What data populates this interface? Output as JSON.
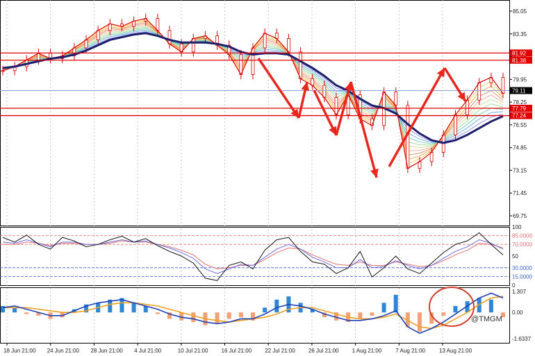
{
  "chart_data": {
    "type": "line",
    "instrument_note": "",
    "colors": {
      "price_candle": "#d60000",
      "trend_ma": "#1c1f6b",
      "level_line": "#e00000",
      "current_price_line": "#8a9fd8",
      "arrow": "#e8261e",
      "stoch_main": "#111111",
      "stoch_signal": "#6a6ae0",
      "stoch_slow": "#e07070",
      "hist_pos": "#2f86d6",
      "hist_neg": "#f2a076",
      "macd_line": "#1c3fb5",
      "signal_line": "#f0a020",
      "circle": "#d63a2a"
    },
    "x_labels": [
      "18 Jun 21:00",
      "24 Jun 21:00",
      "28 Jun 21:00",
      "4 Jul 21:00",
      "10 Jul 21:00",
      "16 Jul 21:00",
      "22 Jul 21:00",
      "26 Jul 21:00",
      "1 Aug 21:00",
      "7 Aug 21:00",
      "13 Aug 21:00"
    ],
    "price_panel": {
      "y_ticks": [
        "85.05",
        "83.35",
        "81.65",
        "79.95",
        "78.25",
        "76.55",
        "74.85",
        "73.15",
        "71.45",
        "69.75"
      ],
      "ylim": [
        69.75,
        85.05
      ],
      "levels": [
        {
          "label": "81.92",
          "value": 81.92
        },
        {
          "label": "81.38",
          "value": 81.38
        },
        {
          "label": "77.79",
          "value": 77.79
        },
        {
          "label": "77.24",
          "value": 77.24
        }
      ],
      "current": {
        "label": "79.11",
        "value": 79.11
      },
      "close": [
        80.6,
        80.9,
        81.4,
        81.9,
        81.5,
        81.7,
        82.3,
        82.9,
        83.6,
        84.1,
        83.9,
        84.3,
        84.5,
        83.6,
        82.6,
        82.0,
        83.0,
        83.2,
        82.5,
        81.8,
        80.3,
        82.3,
        83.4,
        83.0,
        82.0,
        80.0,
        79.5,
        78.6,
        77.3,
        78.8,
        77.0,
        76.5,
        79.0,
        78.0,
        73.3,
        73.8,
        74.5,
        75.8,
        77.3,
        78.4,
        79.7,
        80.1,
        78.9
      ],
      "ma": [
        80.8,
        80.9,
        81.1,
        81.3,
        81.5,
        81.6,
        81.8,
        82.1,
        82.5,
        82.9,
        83.1,
        83.3,
        83.4,
        83.2,
        82.9,
        82.7,
        82.7,
        82.7,
        82.6,
        82.4,
        82.0,
        81.8,
        81.9,
        81.9,
        81.8,
        81.3,
        80.8,
        80.2,
        79.5,
        79.1,
        78.5,
        78.0,
        77.8,
        77.4,
        76.6,
        75.9,
        75.4,
        75.2,
        75.4,
        75.8,
        76.3,
        76.8,
        77.2
      ]
    },
    "oscillator_panel": {
      "y_ticks": [
        "100",
        "85.0000",
        "70.0000",
        "50",
        "30.0000",
        "15.0000",
        "0"
      ],
      "ylim": [
        0,
        100
      ],
      "levels": [
        {
          "label": "85.0000",
          "value": 85,
          "color": "#e07070"
        },
        {
          "label": "70.0000",
          "value": 70,
          "color": "#e07070"
        },
        {
          "label": "30.0000",
          "value": 30,
          "color": "#3f5fd0"
        },
        {
          "label": "15.0000",
          "value": 15,
          "color": "#3f5fd0"
        }
      ],
      "main": [
        82,
        74,
        86,
        70,
        62,
        82,
        76,
        66,
        70,
        78,
        84,
        74,
        80,
        68,
        58,
        50,
        38,
        12,
        8,
        34,
        40,
        28,
        60,
        78,
        82,
        58,
        40,
        36,
        20,
        30,
        58,
        14,
        30,
        50,
        28,
        20,
        38,
        56,
        70,
        76,
        90,
        70,
        52
      ],
      "signal": [
        74,
        72,
        78,
        72,
        66,
        74,
        74,
        70,
        70,
        74,
        78,
        74,
        76,
        70,
        64,
        56,
        46,
        28,
        20,
        28,
        36,
        34,
        48,
        62,
        70,
        62,
        48,
        40,
        30,
        30,
        44,
        30,
        32,
        42,
        34,
        28,
        34,
        46,
        58,
        66,
        78,
        72,
        62
      ],
      "slow": [
        70,
        70,
        74,
        72,
        68,
        72,
        72,
        70,
        70,
        72,
        76,
        74,
        74,
        70,
        66,
        60,
        52,
        36,
        28,
        30,
        34,
        34,
        44,
        56,
        64,
        62,
        52,
        44,
        36,
        34,
        40,
        34,
        34,
        40,
        36,
        32,
        34,
        42,
        52,
        60,
        72,
        70,
        64
      ]
    },
    "macd_panel": {
      "y_ticks": [
        "1.307",
        "0.00",
        "-1.6337"
      ],
      "ylim": [
        -1.6337,
        1.307
      ],
      "hist": [
        0.4,
        0.3,
        -0.1,
        -0.2,
        -0.4,
        -0.3,
        0.2,
        0.5,
        0.6,
        0.8,
        0.9,
        0.6,
        0.4,
        -0.1,
        -0.4,
        -0.5,
        -0.6,
        -0.8,
        -0.7,
        -0.4,
        -0.3,
        -0.5,
        0.3,
        0.8,
        1.0,
        0.6,
        0.2,
        -0.3,
        -0.5,
        -0.6,
        -0.4,
        -0.2,
        0.6,
        1.1,
        -0.9,
        -1.2,
        -0.7,
        -0.2,
        0.4,
        0.7,
        0.9,
        0.8,
        -0.3
      ],
      "macd": [
        0.3,
        0.4,
        0.2,
        0.0,
        -0.2,
        -0.2,
        0.1,
        0.4,
        0.6,
        0.7,
        0.8,
        0.6,
        0.4,
        0.2,
        -0.1,
        -0.3,
        -0.4,
        -0.6,
        -0.7,
        -0.6,
        -0.4,
        -0.4,
        -0.1,
        0.3,
        0.5,
        0.4,
        0.2,
        -0.1,
        -0.3,
        -0.5,
        -0.5,
        -0.4,
        -0.2,
        0.1,
        -0.9,
        -1.3,
        -1.0,
        -0.6,
        -0.1,
        0.4,
        0.9,
        1.2,
        0.9
      ],
      "signal": [
        0.3,
        0.3,
        0.3,
        0.2,
        0.1,
        0.0,
        0.0,
        0.1,
        0.3,
        0.5,
        0.6,
        0.6,
        0.5,
        0.4,
        0.2,
        0.0,
        -0.2,
        -0.4,
        -0.5,
        -0.6,
        -0.5,
        -0.4,
        -0.3,
        -0.1,
        0.2,
        0.3,
        0.3,
        0.1,
        -0.1,
        -0.3,
        -0.4,
        -0.4,
        -0.3,
        -0.1,
        -0.5,
        -0.9,
        -1.0,
        -0.8,
        -0.4,
        0.0,
        0.5,
        0.9,
        1.0
      ]
    },
    "watermark": "@TMGM"
  }
}
